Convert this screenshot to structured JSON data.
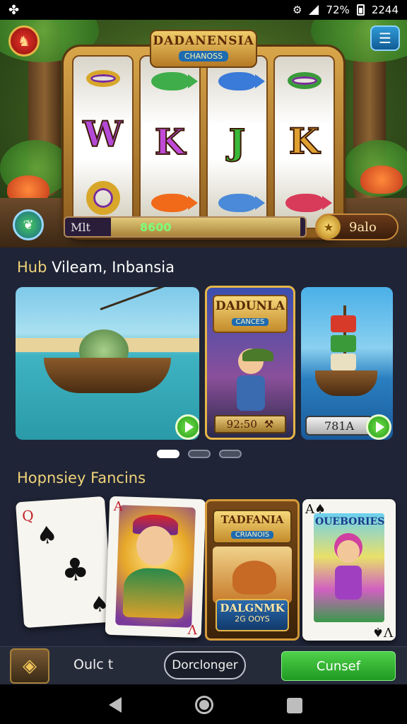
{
  "status_bar": {
    "left_icon": "app-notification-icon",
    "battery_text": "72%",
    "time": "2244",
    "icons": [
      "settings-icon",
      "signal-bars-icon",
      "battery-icon"
    ]
  },
  "hero": {
    "slot_title": "DADANENSIA",
    "slot_subtitle": "CHANOSS",
    "reels": [
      {
        "top": "ring",
        "middle": "W",
        "bottom": "ring"
      },
      {
        "top": "fish",
        "middle": "K",
        "bottom": "fish"
      },
      {
        "top": "fish",
        "middle": "J",
        "bottom": "fish"
      },
      {
        "top": "ring",
        "middle": "K",
        "bottom": "fish"
      }
    ],
    "progress_label": "Mlt",
    "progress_value": "8600",
    "progress_fraction": 0.55,
    "coin_value": "9alo"
  },
  "section1": {
    "title_accent": "Hub",
    "title_rest": " Vileam, Inbansia",
    "cards": [
      {
        "name": "fishing-card"
      },
      {
        "name": "featured-card",
        "banner": "DADUNLA",
        "banner_sub": "CANCES",
        "plate_value": "92:50",
        "plate_icon": "tools-icon"
      },
      {
        "name": "ship-card",
        "plate_value": "781A"
      }
    ],
    "pager_active": 0
  },
  "section2": {
    "title": "Hopnsiey Fancins",
    "cards": [
      {
        "rank": "Q",
        "suit": "♠"
      },
      {
        "rank_tl": "A",
        "rank_br": "V"
      },
      {
        "banner": "TADFANIA",
        "banner_sub": "CRIANOIS",
        "plate": "DALGNMK",
        "plate_sub": "2G OOYS"
      },
      {
        "title": "OUEBORIES",
        "rank_tl": "A♠",
        "rank_br": "V♠"
      }
    ]
  },
  "bottom_bar": {
    "label": "Oulc t",
    "pill_button": "Dorclonger",
    "green_button": "Cunsef"
  },
  "colors": {
    "accent_gold": "#f0d47a",
    "green_button": "#2fae2c",
    "background": "#1f2436"
  }
}
